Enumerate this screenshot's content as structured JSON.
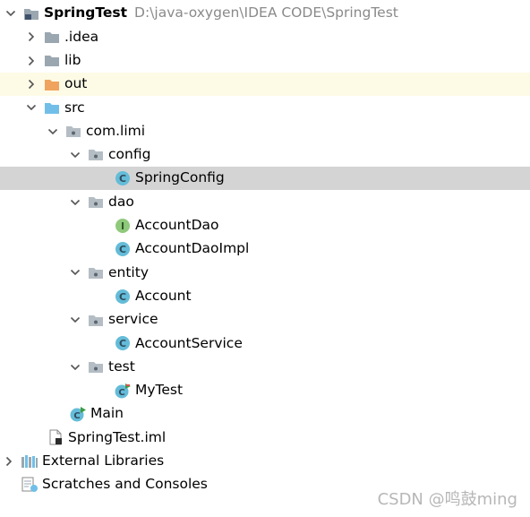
{
  "project_tree": {
    "root": {
      "name": "SpringTest",
      "path": "D:\\java-oxygen\\IDEA CODE\\SpringTest"
    },
    "items": [
      {
        "label": ".idea"
      },
      {
        "label": "lib"
      },
      {
        "label": "out"
      },
      {
        "label": "src"
      },
      {
        "label": "com.limi"
      },
      {
        "label": "config"
      },
      {
        "label": "SpringConfig"
      },
      {
        "label": "dao"
      },
      {
        "label": "AccountDao"
      },
      {
        "label": "AccountDaoImpl"
      },
      {
        "label": "entity"
      },
      {
        "label": "Account"
      },
      {
        "label": "service"
      },
      {
        "label": "AccountService"
      },
      {
        "label": "test"
      },
      {
        "label": "MyTest"
      },
      {
        "label": "Main"
      },
      {
        "label": "SpringTest.iml"
      },
      {
        "label": "External Libraries"
      },
      {
        "label": "Scratches and Consoles"
      }
    ],
    "selected_item": "SpringConfig"
  },
  "icons": {
    "folder_gray": "#9aa7b0",
    "folder_blue": "#71bfe8",
    "folder_orange": "#f0a35e",
    "class_circle": "#64bcd8",
    "interface_circle": "#8fc97b",
    "runnable_badge": "#3d9c45"
  },
  "watermark": "CSDN @鸣鼓ming"
}
